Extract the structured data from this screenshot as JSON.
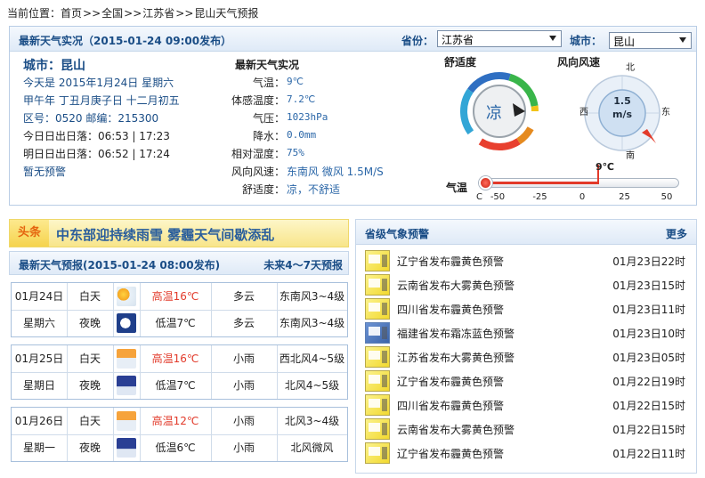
{
  "breadcrumb": {
    "prefix": "当前位置：",
    "items": [
      "首页",
      "全国",
      "江苏省",
      "昆山天气预报"
    ],
    "sep": ">>"
  },
  "realtime": {
    "header_title": "最新天气实况（2015-01-24 09:00发布）",
    "province_label": "省份：",
    "province_value": "江苏省",
    "city_label": "城市：",
    "city_value": "昆山",
    "city_title": "城市：昆山",
    "date_line": "今天是 2015年1月24日 星期六",
    "lunar_line": "甲午年 丁丑月庚子日 十二月初五",
    "zip_line": "区号：0520  邮编：215300",
    "sun_today": "今日日出日落：06:53 | 17:23",
    "sun_tomorrow": "明日日出日落：06:52 | 17:24",
    "no_warning": "暂无预警",
    "obs_title": "最新天气实况",
    "obs": [
      {
        "label": "气温：",
        "value": "9℃",
        "cn": false
      },
      {
        "label": "体感温度：",
        "value": "7.2℃",
        "cn": false
      },
      {
        "label": "气压：",
        "value": "1023hPa",
        "cn": false
      },
      {
        "label": "降水：",
        "value": "0.0mm",
        "cn": false
      },
      {
        "label": "相对湿度：",
        "value": "75%",
        "cn": false
      },
      {
        "label": "风向风速：",
        "value": "东南风 微风 1.5M/S",
        "cn": true
      },
      {
        "label": "舒适度：",
        "value": "凉，不舒适",
        "cn": true
      }
    ],
    "comfort_title": "舒适度",
    "comfort_value": "凉",
    "wind_title": "风向风速",
    "wind_speed": "1.5",
    "wind_unit": "m/s",
    "compass": {
      "n": "北",
      "s": "南",
      "e": "东",
      "w": "西"
    },
    "temp_title": "气温",
    "temp_value": "9℃",
    "temp_unit": "C",
    "temp_ticks": [
      "-50",
      "-25",
      "0",
      "25",
      "50"
    ],
    "temp_fraction": 0.59
  },
  "headline": {
    "tag": "头条",
    "text": "中东部迎持续雨雪 雾霾天气间歇添乱"
  },
  "forecast": {
    "title": "最新天气预报(2015-01-24 08:00发布)",
    "more": "未来4～7天预报",
    "days": [
      {
        "date": "01月24日",
        "weekday": "星期六",
        "rows": [
          {
            "period": "白天",
            "icon": "sun-cloud-icon",
            "temp": "高温16℃",
            "weather": "多云",
            "wind": "东南风3~4级"
          },
          {
            "period": "夜晚",
            "icon": "moon-icon",
            "temp": "低温7℃",
            "weather": "多云",
            "wind": "东南风3~4级"
          }
        ]
      },
      {
        "date": "01月25日",
        "weekday": "星期日",
        "rows": [
          {
            "period": "白天",
            "icon": "rain-day-icon",
            "temp": "高温16℃",
            "weather": "小雨",
            "wind": "西北风4~5级"
          },
          {
            "period": "夜晚",
            "icon": "rain-night-icon",
            "temp": "低温7℃",
            "weather": "小雨",
            "wind": "北风4~5级"
          }
        ]
      },
      {
        "date": "01月26日",
        "weekday": "星期一",
        "rows": [
          {
            "period": "白天",
            "icon": "rain-day-icon",
            "temp": "高温12℃",
            "weather": "小雨",
            "wind": "北风3~4级"
          },
          {
            "period": "夜晚",
            "icon": "rain-night-icon",
            "temp": "低温6℃",
            "weather": "小雨",
            "wind": "北风微风"
          }
        ]
      }
    ]
  },
  "warnings": {
    "title": "省级气象预警",
    "more": "更多",
    "items": [
      {
        "text": "辽宁省发布霾黄色预警",
        "time": "01月23日22时",
        "color": "yellow"
      },
      {
        "text": "云南省发布大雾黄色预警",
        "time": "01月23日15时",
        "color": "yellow"
      },
      {
        "text": "四川省发布霾黄色预警",
        "time": "01月23日11时",
        "color": "yellow"
      },
      {
        "text": "福建省发布霜冻蓝色预警",
        "time": "01月23日10时",
        "color": "blue"
      },
      {
        "text": "江苏省发布大雾黄色预警",
        "time": "01月23日05时",
        "color": "yellow"
      },
      {
        "text": "辽宁省发布霾黄色预警",
        "time": "01月22日19时",
        "color": "yellow"
      },
      {
        "text": "四川省发布霾黄色预警",
        "time": "01月22日15时",
        "color": "yellow"
      },
      {
        "text": "云南省发布大雾黄色预警",
        "time": "01月22日15时",
        "color": "yellow"
      },
      {
        "text": "辽宁省发布霾黄色预警",
        "time": "01月22日11时",
        "color": "yellow"
      }
    ]
  },
  "colors": {
    "title_blue": "#1a4d86",
    "link_blue": "#2b67a8",
    "hot_red": "#e23a2a",
    "banner_orange": "#e5650f"
  }
}
